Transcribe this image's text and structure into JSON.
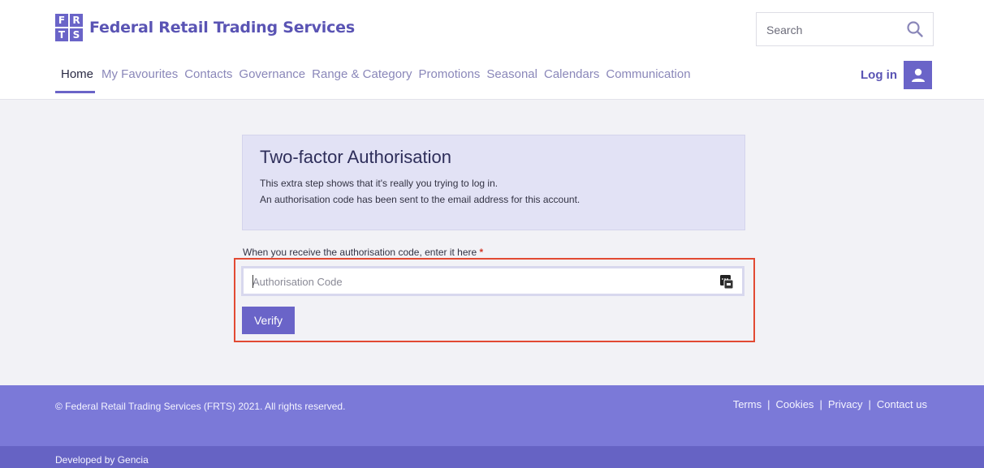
{
  "brand": {
    "logo_letters": [
      "F",
      "R",
      "T",
      "S"
    ],
    "name": "Federal Retail Trading Services"
  },
  "search": {
    "placeholder": "Search",
    "icon": "search-icon"
  },
  "nav": {
    "items": [
      {
        "label": "Home",
        "active": true
      },
      {
        "label": "My Favourites",
        "active": false
      },
      {
        "label": "Contacts",
        "active": false
      },
      {
        "label": "Governance",
        "active": false
      },
      {
        "label": "Range & Category",
        "active": false
      },
      {
        "label": "Promotions",
        "active": false
      },
      {
        "label": "Seasonal",
        "active": false
      },
      {
        "label": "Calendars",
        "active": false
      },
      {
        "label": "Communication",
        "active": false
      }
    ]
  },
  "login": {
    "label": "Log in",
    "icon": "user-icon"
  },
  "auth": {
    "title": "Two-factor Authorisation",
    "line1": "This extra step shows that it's really you trying to log in.",
    "line2": "An authorisation code has been sent to the email address for this account.",
    "field_label": "When you receive the authorisation code, enter it here",
    "required_marker": "*",
    "code_placeholder": "Authorisation Code",
    "code_value": "",
    "verify_label": "Verify",
    "field_icon": "password-key-icon"
  },
  "footer": {
    "copyright": "© Federal Retail Trading Services (FRTS) 2021. All rights reserved.",
    "links": [
      "Terms",
      "Cookies",
      "Privacy",
      "Contact us"
    ],
    "separator": "|",
    "developed_by": "Developed by Gencia"
  },
  "colors": {
    "accent": "#6a64c8",
    "footer": "#7b79d8",
    "sub_footer": "#6663c4",
    "highlight": "#e24a33"
  }
}
